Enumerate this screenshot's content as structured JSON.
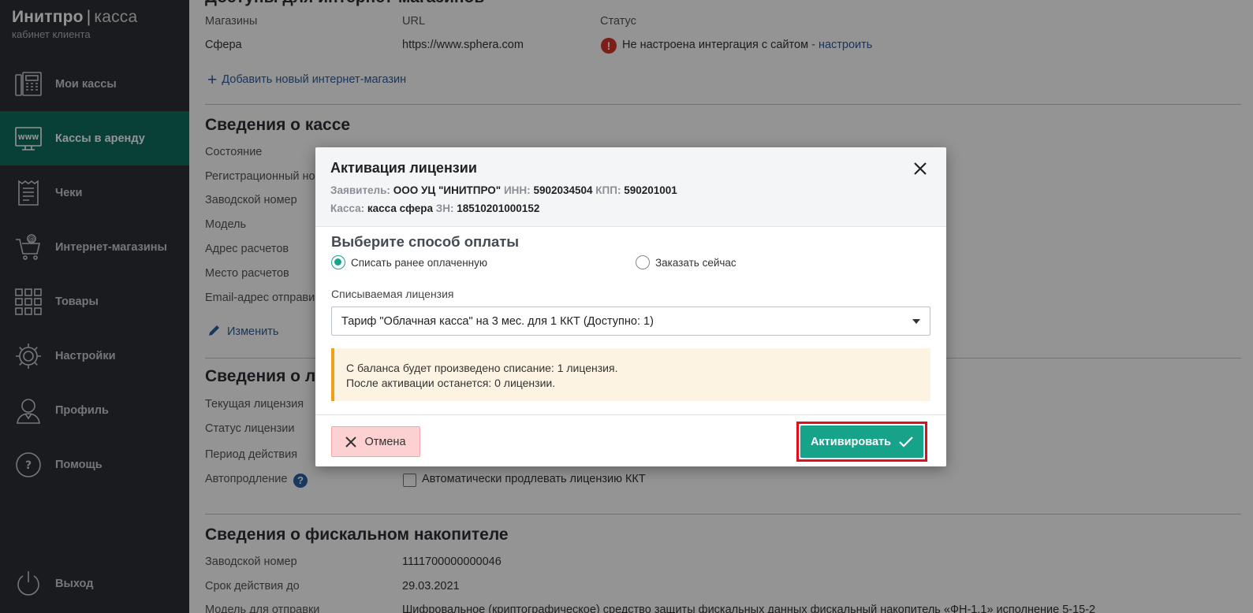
{
  "brand": {
    "name": "Инитпро",
    "separator": "|",
    "product": "касса",
    "subtitle": "кабинет клиента"
  },
  "sidebar": {
    "items": [
      {
        "label": "Мои кассы",
        "icon": "fax-terminal-icon"
      },
      {
        "label": "Кассы в аренду",
        "icon": "www-monitor-icon",
        "active": true
      },
      {
        "label": "Чеки",
        "icon": "receipt-icon"
      },
      {
        "label": "Интернет-магазины",
        "icon": "shopping-cart-icon"
      },
      {
        "label": "Товары",
        "icon": "grid-icon"
      },
      {
        "label": "Настройки",
        "icon": "gear-icon"
      },
      {
        "label": "Профиль",
        "icon": "user-icon"
      },
      {
        "label": "Помощь",
        "icon": "help-icon"
      },
      {
        "label": "Выход",
        "icon": "power-icon"
      }
    ]
  },
  "shops": {
    "heading_partial": "Доступы для интернет-магазинов",
    "col_shops": "Магазины",
    "col_url": "URL",
    "col_status": "Статус",
    "row": {
      "name": "Сфера",
      "url": "https://www.sphera.com",
      "status": "Не настроена интергация с сайтом",
      "status_sep": "-",
      "status_link": "настроить"
    },
    "add_link": "Добавить новый интернет-магазин"
  },
  "kassa": {
    "heading": "Сведения о кассе",
    "labels": [
      "Состояние",
      "Регистрационный но",
      "Заводской номер",
      "Модель",
      "Адрес расчетов",
      "Место расчетов",
      "Email-адрес отправи"
    ],
    "edit_link": "Изменить"
  },
  "license": {
    "heading_partial": "Сведения о л",
    "labels": [
      "Текущая лицензия",
      "Статус лицензии",
      "Период действия",
      "Автопродление"
    ],
    "autorenew_help": "?",
    "autorenew_checkbox_label": "Автоматически продлевать лицензию ККТ"
  },
  "fiscal": {
    "heading": "Сведения о фискальном накопителе",
    "rows": [
      {
        "label": "Заводской номер",
        "value": "1111700000000046"
      },
      {
        "label": "Срок действия до",
        "value": "29.03.2021"
      },
      {
        "label": "Модель для отправки",
        "value": "Шифровальное (криптографическое) средство защиты фискальных данных фискальный накопитель «ФН-1.1» исполнение 5-15-2"
      }
    ]
  },
  "modal": {
    "title": "Активация лицензии",
    "applicant_label": "Заявитель:",
    "applicant_value": "ООО УЦ \"ИНИТПРО\"",
    "inn_label": "ИНН:",
    "inn_value": "5902034504",
    "kpp_label": "КПП:",
    "kpp_value": "590201001",
    "kassa_label": "Касса:",
    "kassa_value": "касса сфера",
    "zn_label": "ЗН:",
    "zn_value": "18510201000152",
    "payment_title": "Выберите способ оплаты",
    "option_prepaid": "Списать ранее оплаченную",
    "option_order": "Заказать сейчас",
    "selected_option": "Списать ранее оплаченную",
    "license_field_label": "Списываемая лицензия",
    "license_selected": "Тариф \"Облачная касса\" на 3 мес. для 1 ККТ (Доступно: 1)",
    "notice_line1": "С баланса будет произведено списание: 1 лицензия.",
    "notice_line2": "После активации останется: 0 лицензии.",
    "cancel_label": "Отмена",
    "activate_label": "Активировать"
  },
  "colors": {
    "sidebar_bg": "#2c2f36",
    "active_nav": "#0e6d5f",
    "accent": "#17a389",
    "link": "#2f5d9c",
    "error": "#d9342b",
    "highlight": "#e0101a",
    "notice_border": "#f2a01b"
  }
}
